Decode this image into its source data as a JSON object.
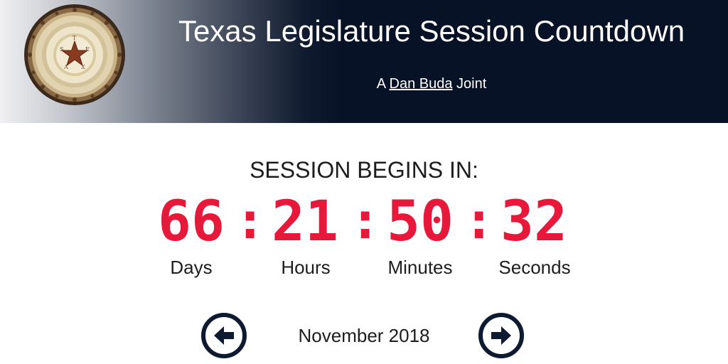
{
  "header": {
    "title": "Texas Legislature Session Countdown",
    "byline_prefix": "A",
    "byline_link": "Dan Buda",
    "byline_suffix": "Joint",
    "seal_icon": "texas-capitol-dome-star-icon"
  },
  "countdown": {
    "heading": "SESSION BEGINS IN:",
    "separator": ":",
    "days": "66",
    "hours": "21",
    "minutes": "50",
    "seconds": "32",
    "labels": {
      "days": "Days",
      "hours": "Hours",
      "minutes": "Minutes",
      "seconds": "Seconds"
    }
  },
  "navigation": {
    "current_month": "November 2018",
    "prev_icon": "arrow-left-circle-icon",
    "next_icon": "arrow-right-circle-icon"
  },
  "colors": {
    "header_dark": "#071226",
    "countdown_red": "#e8183b",
    "nav_circle": "#0e1a30",
    "text": "#1d1d1d"
  }
}
